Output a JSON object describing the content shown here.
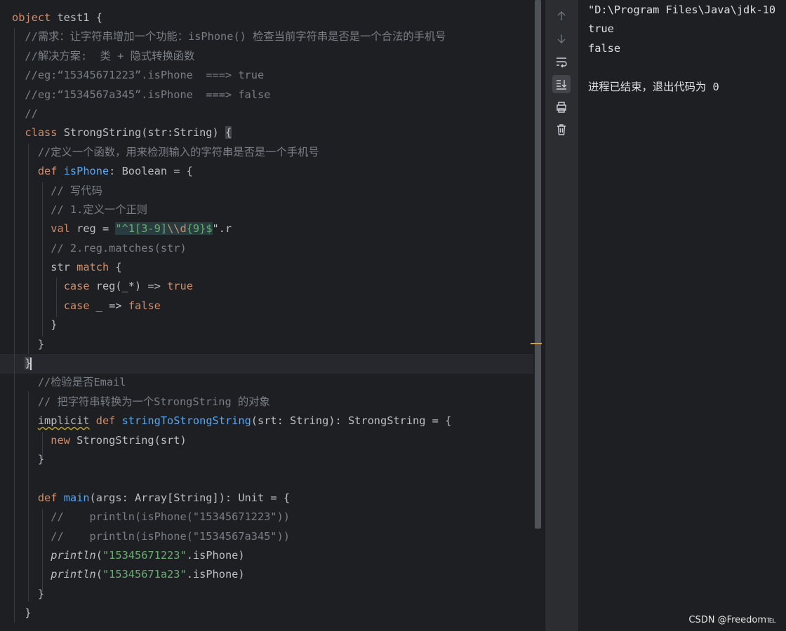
{
  "editor": {
    "lines": [
      [
        {
          "t": "object ",
          "c": "kw"
        },
        {
          "t": "test1 {",
          "c": ""
        }
      ],
      [
        {
          "t": "  //需求：让字符串增加一个功能：isPhone() 检查当前字符串是否是一个合法的手机号",
          "c": "cm"
        }
      ],
      [
        {
          "t": "  //解决方案:  类 + 隐式转换函数",
          "c": "cm"
        }
      ],
      [
        {
          "t": "  //eg:“15345671223”.isPhone  ===> true",
          "c": "cm"
        }
      ],
      [
        {
          "t": "  //eg:“1534567a345”.isPhone  ===> false",
          "c": "cm"
        }
      ],
      [
        {
          "t": "  //",
          "c": "cm"
        }
      ],
      [
        {
          "t": "  ",
          "c": ""
        },
        {
          "t": "class ",
          "c": "kw"
        },
        {
          "t": "StrongString(str:String) ",
          "c": ""
        },
        {
          "t": "{",
          "c": "bh"
        }
      ],
      [
        {
          "t": "    //定义一个函数，用来检测输入的字符串是否是一个手机号",
          "c": "cm"
        }
      ],
      [
        {
          "t": "    ",
          "c": ""
        },
        {
          "t": "def ",
          "c": "kw"
        },
        {
          "t": "isPhone",
          "c": "fn"
        },
        {
          "t": ": Boolean = {",
          "c": ""
        }
      ],
      [
        {
          "t": "      // 写代码",
          "c": "cm"
        }
      ],
      [
        {
          "t": "      // 1.定义一个正则",
          "c": "cm"
        }
      ],
      [
        {
          "t": "      ",
          "c": ""
        },
        {
          "t": "val ",
          "c": "kw"
        },
        {
          "t": "reg = ",
          "c": ""
        },
        {
          "t": "\"^1[3-9]",
          "c": "rgx"
        },
        {
          "t": "\\\\d",
          "c": "rgxe"
        },
        {
          "t": "{9}$",
          "c": "rgx"
        },
        {
          "t": "\".r",
          "c": ""
        }
      ],
      [
        {
          "t": "      // 2.reg.matches(str)",
          "c": "cm"
        }
      ],
      [
        {
          "t": "      ",
          "c": ""
        },
        {
          "t": "str ",
          "c": ""
        },
        {
          "t": "match ",
          "c": "kw"
        },
        {
          "t": "{",
          "c": ""
        }
      ],
      [
        {
          "t": "        ",
          "c": ""
        },
        {
          "t": "case ",
          "c": "kw"
        },
        {
          "t": "reg(_*) => ",
          "c": ""
        },
        {
          "t": "true",
          "c": "kw"
        }
      ],
      [
        {
          "t": "        ",
          "c": ""
        },
        {
          "t": "case ",
          "c": "kw"
        },
        {
          "t": "_ => ",
          "c": ""
        },
        {
          "t": "false",
          "c": "kw"
        }
      ],
      [
        {
          "t": "      }",
          "c": ""
        }
      ],
      [
        {
          "t": "    }",
          "c": ""
        }
      ],
      [
        {
          "t": "  ",
          "c": ""
        },
        {
          "t": "}",
          "c": "bh"
        },
        {
          "t": "",
          "c": "caret"
        }
      ],
      [
        {
          "t": "    //检验是否Email",
          "c": "cm"
        }
      ],
      [
        {
          "t": "    // 把字符串转换为一个StrongString 的对象",
          "c": "cm"
        }
      ],
      [
        {
          "t": "    ",
          "c": ""
        },
        {
          "t": "implicit",
          "c": "kwu"
        },
        {
          "t": " def ",
          "c": "kw"
        },
        {
          "t": "stringToStrongString",
          "c": "fn"
        },
        {
          "t": "(srt: String): StrongString = {",
          "c": ""
        }
      ],
      [
        {
          "t": "      ",
          "c": ""
        },
        {
          "t": "new ",
          "c": "kw"
        },
        {
          "t": "StrongString(srt)",
          "c": ""
        }
      ],
      [
        {
          "t": "    }",
          "c": ""
        }
      ],
      [
        {
          "t": "",
          "c": ""
        }
      ],
      [
        {
          "t": "    ",
          "c": ""
        },
        {
          "t": "def ",
          "c": "kw"
        },
        {
          "t": "main",
          "c": "fn"
        },
        {
          "t": "(args: Array[String]): Unit = {",
          "c": ""
        }
      ],
      [
        {
          "t": "      //    println(isPhone(\"15345671223\"))",
          "c": "cm"
        }
      ],
      [
        {
          "t": "      //    println(isPhone(\"1534567a345\"))",
          "c": "cm"
        }
      ],
      [
        {
          "t": "      ",
          "c": ""
        },
        {
          "t": "println",
          "c": "it"
        },
        {
          "t": "(",
          "c": ""
        },
        {
          "t": "\"15345671223\"",
          "c": "str"
        },
        {
          "t": ".isPhone)",
          "c": ""
        }
      ],
      [
        {
          "t": "      ",
          "c": ""
        },
        {
          "t": "println",
          "c": "it"
        },
        {
          "t": "(",
          "c": ""
        },
        {
          "t": "\"15345671a23\"",
          "c": "str"
        },
        {
          "t": ".isPhone)",
          "c": ""
        }
      ],
      [
        {
          "t": "    }",
          "c": ""
        }
      ],
      [
        {
          "t": "  }",
          "c": ""
        }
      ]
    ]
  },
  "toolbar": {
    "icons": [
      "up-arrow-icon",
      "down-arrow-icon",
      "soft-wrap-icon",
      "scroll-to-end-icon",
      "print-icon",
      "trash-icon"
    ]
  },
  "console": {
    "lines": [
      "\"D:\\Program Files\\Java\\jdk-10",
      "true",
      "false",
      "",
      "进程已结束，退出代码为 0"
    ]
  },
  "watermark": "CSDN @Freedom℡"
}
